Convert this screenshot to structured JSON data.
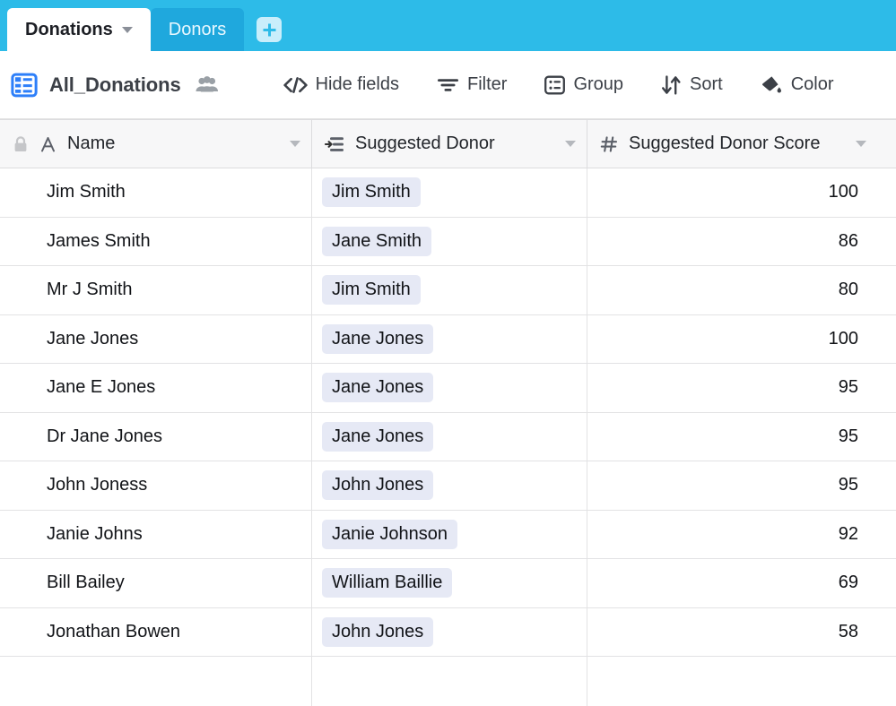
{
  "tabs": {
    "items": [
      {
        "label": "Donations",
        "active": true,
        "has_caret": true
      },
      {
        "label": "Donors",
        "active": false,
        "has_caret": false
      }
    ],
    "add_tab_icon": "plus-icon"
  },
  "toolbar": {
    "grid_icon": "grid-view-icon",
    "view_name": "All_Donations",
    "collaborators_icon": "collaborators-icon",
    "buttons": [
      {
        "label": "Hide fields",
        "icon": "hide-fields-icon"
      },
      {
        "label": "Filter",
        "icon": "filter-icon"
      },
      {
        "label": "Group",
        "icon": "group-icon"
      },
      {
        "label": "Sort",
        "icon": "sort-icon"
      },
      {
        "label": "Color",
        "icon": "color-icon"
      }
    ]
  },
  "table": {
    "columns": [
      {
        "label": "Name",
        "icon": "text-field-icon",
        "lock": "lock-icon",
        "align": "left"
      },
      {
        "label": "Suggested Donor",
        "icon": "linked-record-icon",
        "align": "left"
      },
      {
        "label": "Suggested Donor Score",
        "icon": "number-field-icon",
        "align": "right"
      }
    ],
    "rows": [
      {
        "name": "Jim Smith",
        "suggested_donor": "Jim Smith",
        "score": "100"
      },
      {
        "name": "James Smith",
        "suggested_donor": "Jane Smith",
        "score": "86"
      },
      {
        "name": "Mr J Smith",
        "suggested_donor": "Jim Smith",
        "score": "80"
      },
      {
        "name": "Jane Jones",
        "suggested_donor": "Jane Jones",
        "score": "100"
      },
      {
        "name": "Jane E Jones",
        "suggested_donor": "Jane Jones",
        "score": "95"
      },
      {
        "name": "Dr Jane Jones",
        "suggested_donor": "Jane Jones",
        "score": "95"
      },
      {
        "name": "John Joness",
        "suggested_donor": "John Jones",
        "score": "95"
      },
      {
        "name": "Janie Johns",
        "suggested_donor": "Janie Johnson",
        "score": "92"
      },
      {
        "name": "Bill Bailey",
        "suggested_donor": "William Baillie",
        "score": "69"
      },
      {
        "name": "Jonathan Bowen",
        "suggested_donor": "John Jones",
        "score": "58"
      }
    ]
  },
  "colors": {
    "tabbar_blue": "#2dbbe8",
    "tab_inactive_blue": "#1fa8dd",
    "accent_blue": "#2d7ff9",
    "chip_background": "#e6e9f5",
    "header_background": "#f7f7f8"
  }
}
